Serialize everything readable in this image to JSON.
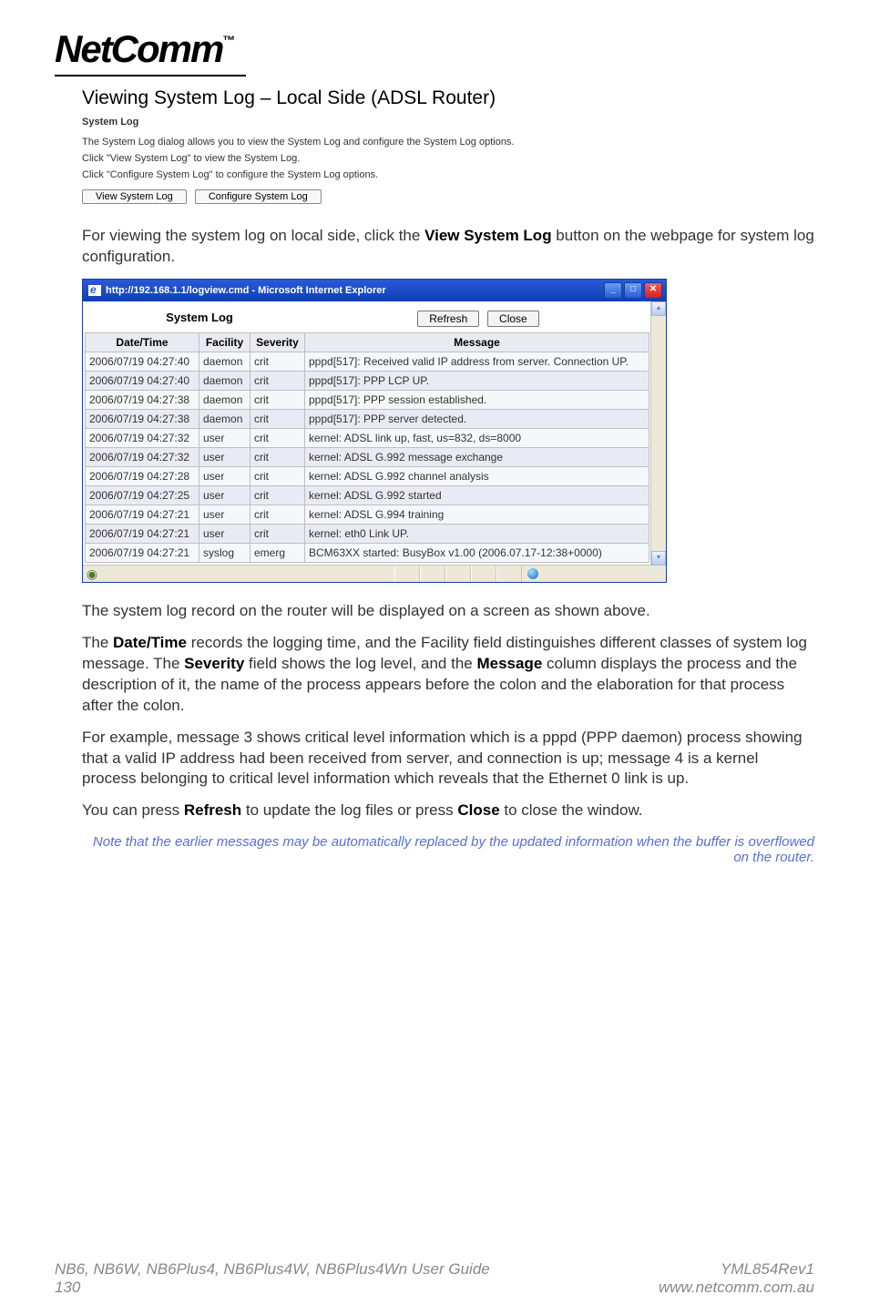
{
  "brand": {
    "name": "NetComm",
    "tm": "™"
  },
  "section_title": "Viewing System Log – Local Side (ADSL Router)",
  "syslog_config": {
    "title": "System Log",
    "intro": "The System Log dialog allows you to view the System Log and configure the System Log options.",
    "line_view": "Click \"View System Log\" to view the System Log.",
    "line_conf": "Click \"Configure System Log\" to configure the System Log options.",
    "btn_view": "View System Log",
    "btn_conf": "Configure System Log"
  },
  "para1_a": "For viewing the system log on local side, click the ",
  "para1_b": "View System Log",
  "para1_c": " button on the webpage for system log configuration.",
  "ie_window": {
    "title": "http://192.168.1.1/logview.cmd - Microsoft Internet Explorer",
    "panel_title": "System Log",
    "btn_refresh": "Refresh",
    "btn_close": "Close",
    "headers": {
      "dt": "Date/Time",
      "fac": "Facility",
      "sev": "Severity",
      "msg": "Message"
    },
    "rows": [
      {
        "dt": "2006/07/19 04:27:40",
        "fac": "daemon",
        "sev": "crit",
        "msg": "pppd[517]: Received valid IP address from server. Connection UP."
      },
      {
        "dt": "2006/07/19 04:27:40",
        "fac": "daemon",
        "sev": "crit",
        "msg": "pppd[517]: PPP LCP UP."
      },
      {
        "dt": "2006/07/19 04:27:38",
        "fac": "daemon",
        "sev": "crit",
        "msg": "pppd[517]: PPP session established."
      },
      {
        "dt": "2006/07/19 04:27:38",
        "fac": "daemon",
        "sev": "crit",
        "msg": "pppd[517]: PPP server detected."
      },
      {
        "dt": "2006/07/19 04:27:32",
        "fac": "user",
        "sev": "crit",
        "msg": "kernel: ADSL link up, fast, us=832, ds=8000"
      },
      {
        "dt": "2006/07/19 04:27:32",
        "fac": "user",
        "sev": "crit",
        "msg": "kernel: ADSL G.992 message exchange"
      },
      {
        "dt": "2006/07/19 04:27:28",
        "fac": "user",
        "sev": "crit",
        "msg": "kernel: ADSL G.992 channel analysis"
      },
      {
        "dt": "2006/07/19 04:27:25",
        "fac": "user",
        "sev": "crit",
        "msg": "kernel: ADSL G.992 started"
      },
      {
        "dt": "2006/07/19 04:27:21",
        "fac": "user",
        "sev": "crit",
        "msg": "kernel: ADSL G.994 training"
      },
      {
        "dt": "2006/07/19 04:27:21",
        "fac": "user",
        "sev": "crit",
        "msg": "kernel: eth0 Link UP."
      },
      {
        "dt": "2006/07/19 04:27:21",
        "fac": "syslog",
        "sev": "emerg",
        "msg": "BCM63XX started: BusyBox v1.00 (2006.07.17-12:38+0000)"
      }
    ]
  },
  "para2": "The system log record on the router will be displayed on a screen as shown above.",
  "para3_a": "The ",
  "para3_b": "Date/Time",
  "para3_c": " records the logging time, and the Facility field distinguishes different classes of system log message. The ",
  "para3_d": "Severity",
  "para3_e": " field shows the log level, and the ",
  "para3_f": "Message",
  "para3_g": " column displays the process and the description of it, the name of the process appears before the colon and the elaboration for that process after the colon.",
  "para4": "For example, message 3 shows critical level information which is a pppd (PPP daemon) process showing that a valid IP address had been received from server, and connection is up; message 4 is a kernel process belonging to critical level information which reveals that the Ethernet 0 link is up.",
  "para5_a": "You can press ",
  "para5_b": "Refresh",
  "para5_c": " to update the log files or press ",
  "para5_d": "Close",
  "para5_e": " to close the window.",
  "note": "Note that the earlier messages may be automatically replaced by the updated information when the buffer is overflowed on the router.",
  "footer": {
    "left1": "NB6, NB6W, NB6Plus4, NB6Plus4W, NB6Plus4Wn User Guide",
    "left2": "130",
    "right1": "YML854Rev1",
    "right2": "www.netcomm.com.au"
  }
}
